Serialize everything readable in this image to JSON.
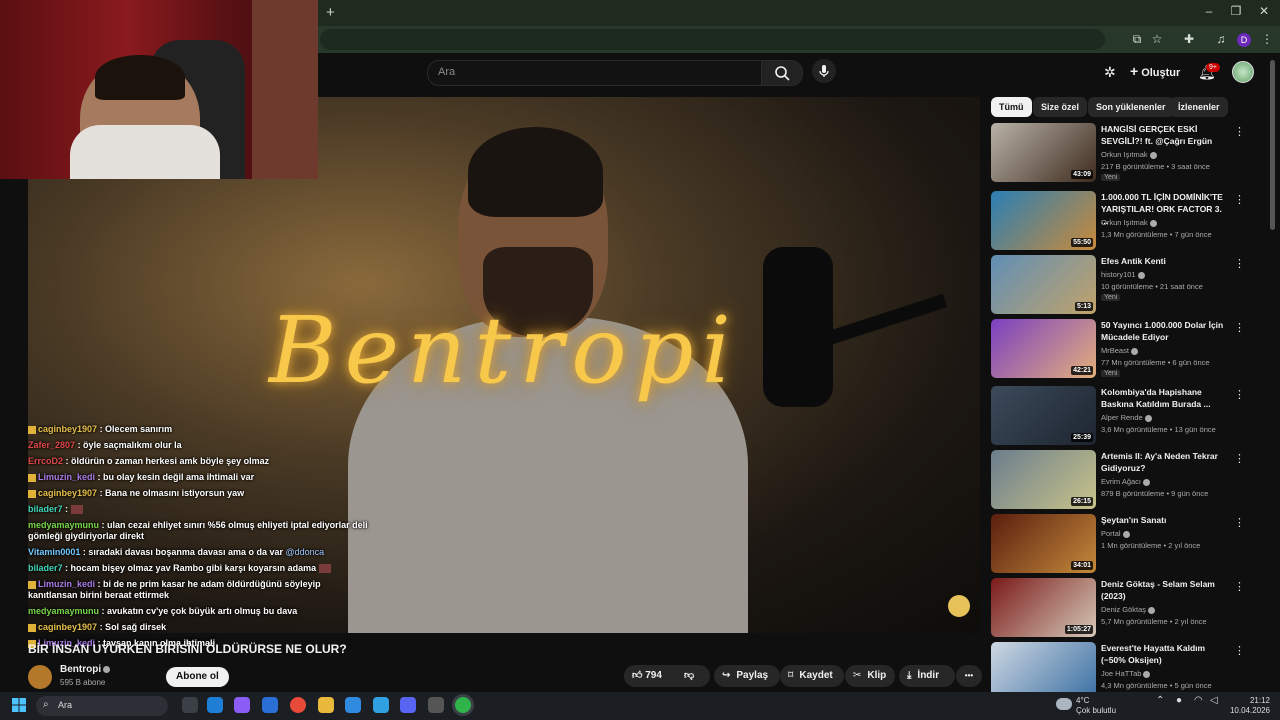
{
  "browser": {
    "new_tab": "+",
    "win_min": "–",
    "win_max": "❐",
    "win_close": "✕",
    "profile_initial": "D"
  },
  "header": {
    "search_placeholder": "Ara",
    "create_label": "Oluştur",
    "notif_badge": "9+"
  },
  "video": {
    "logo_text": "Bentropi",
    "title": "BİR İNSAN UYURKEN BİRİSİNİ ÖLDÜRÜRSE NE OLUR?",
    "channel": "Bentropi",
    "subs": "595 B abone",
    "subscribe_label": "Abone ol",
    "likes": "794",
    "share": "Paylaş",
    "save": "Kaydet",
    "clip": "Klip",
    "download": "İndir",
    "more": "•••"
  },
  "chat": [
    {
      "user": "caginbey1907",
      "color": "#e6c04a",
      "text": ": Olecem sanırım",
      "icon": true
    },
    {
      "user": "Zafer_2807",
      "color": "#e0484a",
      "text": ": öyle saçmalıkmı olur la",
      "icon": false
    },
    {
      "user": "ErrcoD2",
      "color": "#e0484a",
      "text": ": öldürün o zaman herkesi amk böyle şey olmaz",
      "icon": false
    },
    {
      "user": "Limuzin_kedi",
      "color": "#a77be6",
      "text": ": bu olay kesin değil ama ihtimali var",
      "icon": true
    },
    {
      "user": "caginbey1907",
      "color": "#e6c04a",
      "text": ": Bana ne olmasını istiyorsun yaw",
      "icon": true
    },
    {
      "user": "bilader7",
      "color": "#3fd6b8",
      "text": ":",
      "icon": false,
      "emote": true
    },
    {
      "user": "medyamaymunu",
      "color": "#77d64a",
      "text": ": ulan cezai ehliyet sınırı %56 olmuş ehliyeti iptal ediyorlar deli gömleği giydiriyorlar direkt",
      "icon": false
    },
    {
      "user": "Vitamin0001",
      "color": "#6fc8ff",
      "text": ": sıradaki davası boşanma davası ama o da var",
      "mention": "@ddonca",
      "icon": false
    },
    {
      "user": "bilader7",
      "color": "#3fd6b8",
      "text": ": hocam bişey olmaz yav Rambo gibi karşı koyarsın adama",
      "icon": false,
      "emote": true
    },
    {
      "user": "Limuzin_kedi",
      "color": "#a77be6",
      "text": ": bi de ne prim kasar he adam öldürdüğünü söyleyip kanıtlansan birini beraat ettirmek",
      "icon": true
    },
    {
      "user": "medyamaymunu",
      "color": "#77d64a",
      "text": ": avukatın cv'ye çok büyük artı olmuş bu dava",
      "icon": false
    },
    {
      "user": "caginbey1907",
      "color": "#e6c04a",
      "text": ": Sol sağ dirsek",
      "icon": true
    },
    {
      "user": "Limuzin_kedi",
      "color": "#a77be6",
      "text": ": tavşan kanın olma ihtimali",
      "icon": true
    }
  ],
  "chips": [
    "Tümü",
    "Size özel",
    "Son yüklenenler",
    "İzlenenler"
  ],
  "recommended": [
    {
      "title": "HANGİSİ GERÇEK ESKİ SEVGİLİ?! ft. @Çağrı Ergün",
      "channel": "Orkun Işıtmak",
      "meta": "217 B görüntüleme • 3 saat önce",
      "duration": "43:09",
      "badge": "Yeni",
      "color1": "#b9b2a8",
      "color2": "#3e2b1e"
    },
    {
      "title": "1.000.000 TL İÇİN DOMİNİK'TE YARIŞTILAR! ORK FACTOR 3. ...",
      "channel": "Orkun Işıtmak",
      "meta": "1,3 Mn görüntüleme • 7 gün önce",
      "duration": "55:50",
      "badge": "",
      "color1": "#2a7fb5",
      "color2": "#c98a3a"
    },
    {
      "title": "Efes Antik Kenti",
      "channel": "history101",
      "meta": "10 görüntüleme • 21 saat önce",
      "duration": "5:13",
      "badge": "Yeni",
      "color1": "#5f8fb5",
      "color2": "#c2a36a"
    },
    {
      "title": "50 Yayıncı 1.000.000 Dolar İçin Mücadele Ediyor",
      "channel": "MrBeast",
      "meta": "77 Mn görüntüleme • 6 gün önce",
      "duration": "42:21",
      "badge": "Yeni",
      "color1": "#7b3fc2",
      "color2": "#e3b07a"
    },
    {
      "title": "Kolombiya'da Hapishane Baskına Katıldım Burada ...",
      "channel": "Alper Rende",
      "meta": "3,6 Mn görüntüleme • 13 gün önce",
      "duration": "25:39",
      "badge": "",
      "color1": "#3c4a5a",
      "color2": "#1d2530"
    },
    {
      "title": "Artemis II: Ay'a Neden Tekrar Gidiyoruz?",
      "channel": "Evrim Ağacı",
      "meta": "879 B görüntüleme • 9 gün önce",
      "duration": "26:15",
      "badge": "",
      "color1": "#6a7d8c",
      "color2": "#c9c48a"
    },
    {
      "title": "Şeytan'ın Sanatı",
      "channel": "Portal",
      "meta": "1 Mn görüntüleme • 2 yıl önce",
      "duration": "34:01",
      "badge": "",
      "color1": "#5a1e0e",
      "color2": "#c48a3a"
    },
    {
      "title": "Deniz Göktaş - Selam Selam (2023)",
      "channel": "Deniz Göktaş",
      "meta": "5,7 Mn görüntüleme • 2 yıl önce",
      "duration": "1:05:27",
      "badge": "",
      "color1": "#7a1a1a",
      "color2": "#d6c9b8"
    },
    {
      "title": "Everest'te Hayatta Kaldım (−50% Oksijen)",
      "channel": "Joe HaTTab",
      "meta": "4,3 Mn görüntüleme • 5 gün önce",
      "duration": "",
      "badge": "",
      "color1": "#cfd8e2",
      "color2": "#3a6fa3"
    }
  ],
  "taskbar": {
    "search": "Ara",
    "weather_temp": "4°C",
    "weather_desc": "Çok bulutlu",
    "time": "21:12",
    "date": "10.04.2026"
  }
}
